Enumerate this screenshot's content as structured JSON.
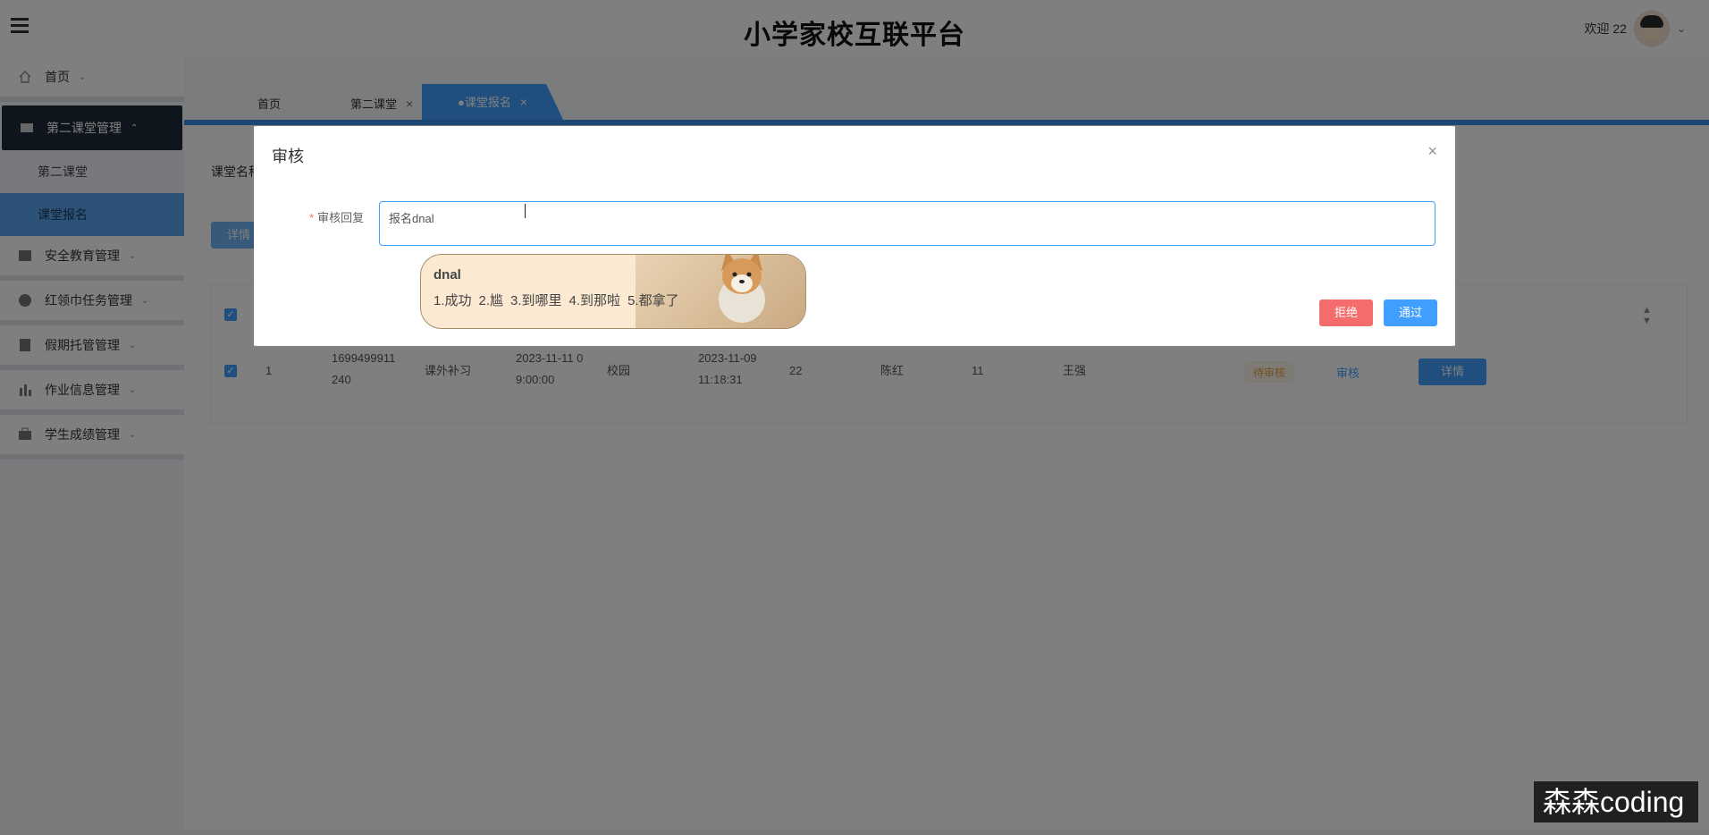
{
  "header": {
    "title": "小学家校互联平台",
    "welcome": "欢迎 22"
  },
  "sidebar": {
    "items": [
      {
        "label": "首页"
      },
      {
        "label": "第二课堂管理"
      },
      {
        "label": "安全教育管理"
      },
      {
        "label": "红领巾任务管理"
      },
      {
        "label": "假期托管管理"
      },
      {
        "label": "作业信息管理"
      },
      {
        "label": "学生成绩管理"
      }
    ],
    "subitems": [
      {
        "label": "第二课堂"
      },
      {
        "label": "课堂报名"
      }
    ]
  },
  "tabs": [
    {
      "label": "首页"
    },
    {
      "label": "第二课堂"
    },
    {
      "label": "●课堂报名"
    }
  ],
  "content": {
    "filter_label": "课堂名称",
    "detail_button": "详情",
    "row": {
      "index": "1",
      "order_no_1": "1699499911",
      "order_no_2": "240",
      "type": "课外补习",
      "time_1": "2023-11-11 0",
      "time_2": "9:00:00",
      "place": "校园",
      "date_1": "2023-11-09",
      "date_2": "11:18:31",
      "num": "22",
      "teacher": "陈红",
      "count": "11",
      "student": "王强",
      "status": "待审核",
      "audit_link": "审核",
      "detail_btn": "详情"
    }
  },
  "dialog": {
    "title": "审核",
    "label": "审核回复",
    "reply_value": "报名dnal",
    "reject": "拒绝",
    "pass": "通过"
  },
  "ime": {
    "input": "dnal",
    "candidates": [
      "1.成功",
      "2.尴",
      "3.到哪里",
      "4.到那啦",
      "5.都拿了"
    ]
  },
  "watermark": "森森coding"
}
